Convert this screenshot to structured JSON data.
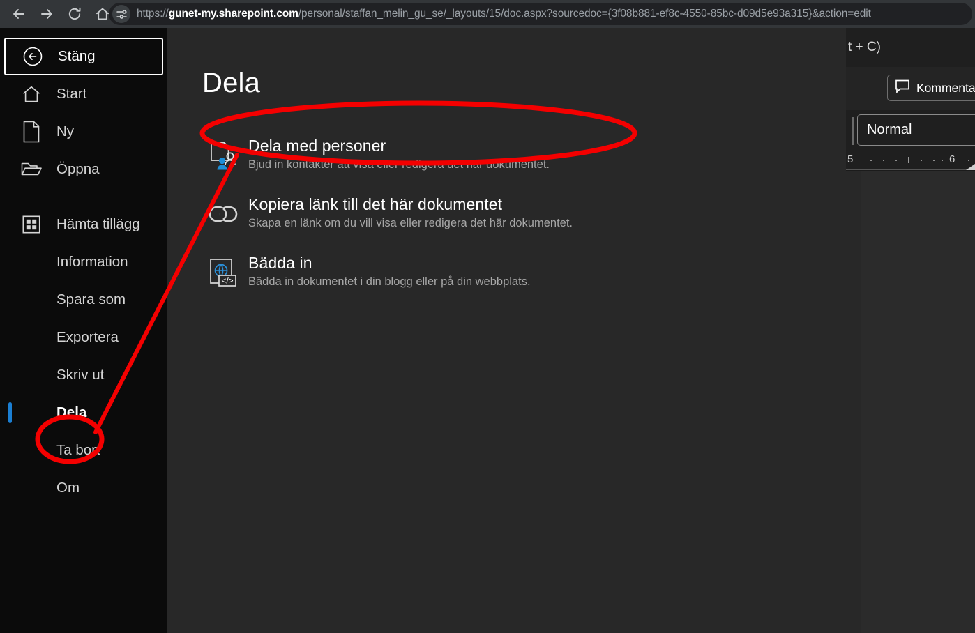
{
  "browser": {
    "nav": [
      {
        "name": "back-button",
        "label": "Back"
      },
      {
        "name": "forward-button",
        "label": "Forward"
      },
      {
        "name": "reload-button",
        "label": "Reload"
      },
      {
        "name": "home-button",
        "label": "Home"
      }
    ],
    "site_settings_icon": "sliders-icon",
    "url": {
      "scheme": "https://",
      "host_prefix": "gunet-my",
      "host_bold": ".sharepoint.com",
      "path": "/personal/staffan_melin_gu_se/_layouts/15/doc.aspx?sourcedoc={3f08b881-ef8c-4550-85bc-d09d5e93a315}&action=edit",
      "full": "https://gunet-my.sharepoint.com/personal/staffan_melin_gu_se/_layouts/15/doc.aspx?sourcedoc={3f08b881-ef8c-4550-85bc-d09d5e93a315}&action=edit"
    }
  },
  "sidebar": {
    "close_item": {
      "label": "Stäng",
      "icon": "back-arrow-circle-icon"
    },
    "items": [
      {
        "label": "Start",
        "icon": "home-icon",
        "has_icon": true,
        "selected": false
      },
      {
        "label": "Ny",
        "icon": "new-document-icon",
        "has_icon": true,
        "selected": false
      },
      {
        "label": "Öppna",
        "icon": "open-folder-icon",
        "has_icon": true,
        "selected": false
      },
      {
        "label": "Hämta tillägg",
        "icon": "add-ins-grid-icon",
        "has_icon": true,
        "selected": false
      },
      {
        "label": "Information",
        "icon": "",
        "has_icon": false,
        "selected": false
      },
      {
        "label": "Spara som",
        "icon": "",
        "has_icon": false,
        "selected": false
      },
      {
        "label": "Exportera",
        "icon": "",
        "has_icon": false,
        "selected": false
      },
      {
        "label": "Skriv ut",
        "icon": "",
        "has_icon": false,
        "selected": false
      },
      {
        "label": "Dela",
        "icon": "",
        "has_icon": false,
        "selected": true
      },
      {
        "label": "Ta bort",
        "icon": "",
        "has_icon": false,
        "selected": false
      },
      {
        "label": "Om",
        "icon": "",
        "has_icon": false,
        "selected": false
      }
    ]
  },
  "main": {
    "title": "Dela",
    "options": [
      {
        "id": "share-with-people",
        "icon": "share-with-people-icon",
        "title": "Dela med personer",
        "desc": "Bjud in kontakter att visa eller redigera det här dokumentet."
      },
      {
        "id": "copy-link",
        "icon": "link-chain-icon",
        "title": "Kopiera länk till det här dokumentet",
        "desc": "Skapa en länk om du vill visa eller redigera det här dokumentet."
      },
      {
        "id": "embed",
        "icon": "embed-code-icon",
        "title": "Bädda in",
        "desc": "Bädda in dokumentet i din blogg eller på din webbplats."
      }
    ]
  },
  "document_window": {
    "tooltip_fragment": "t + C)",
    "comments_button": {
      "label": "Kommenta",
      "icon": "comment-bubble-icon"
    },
    "style_combo": {
      "value": "Normal"
    },
    "ruler": {
      "labels": [
        "5",
        "6"
      ]
    }
  },
  "annotation": {
    "color": "#f40000",
    "shapes": [
      "ellipse-around-dela-sidebar-item",
      "ellipse-around-dela-med-personer",
      "connector-line"
    ]
  }
}
